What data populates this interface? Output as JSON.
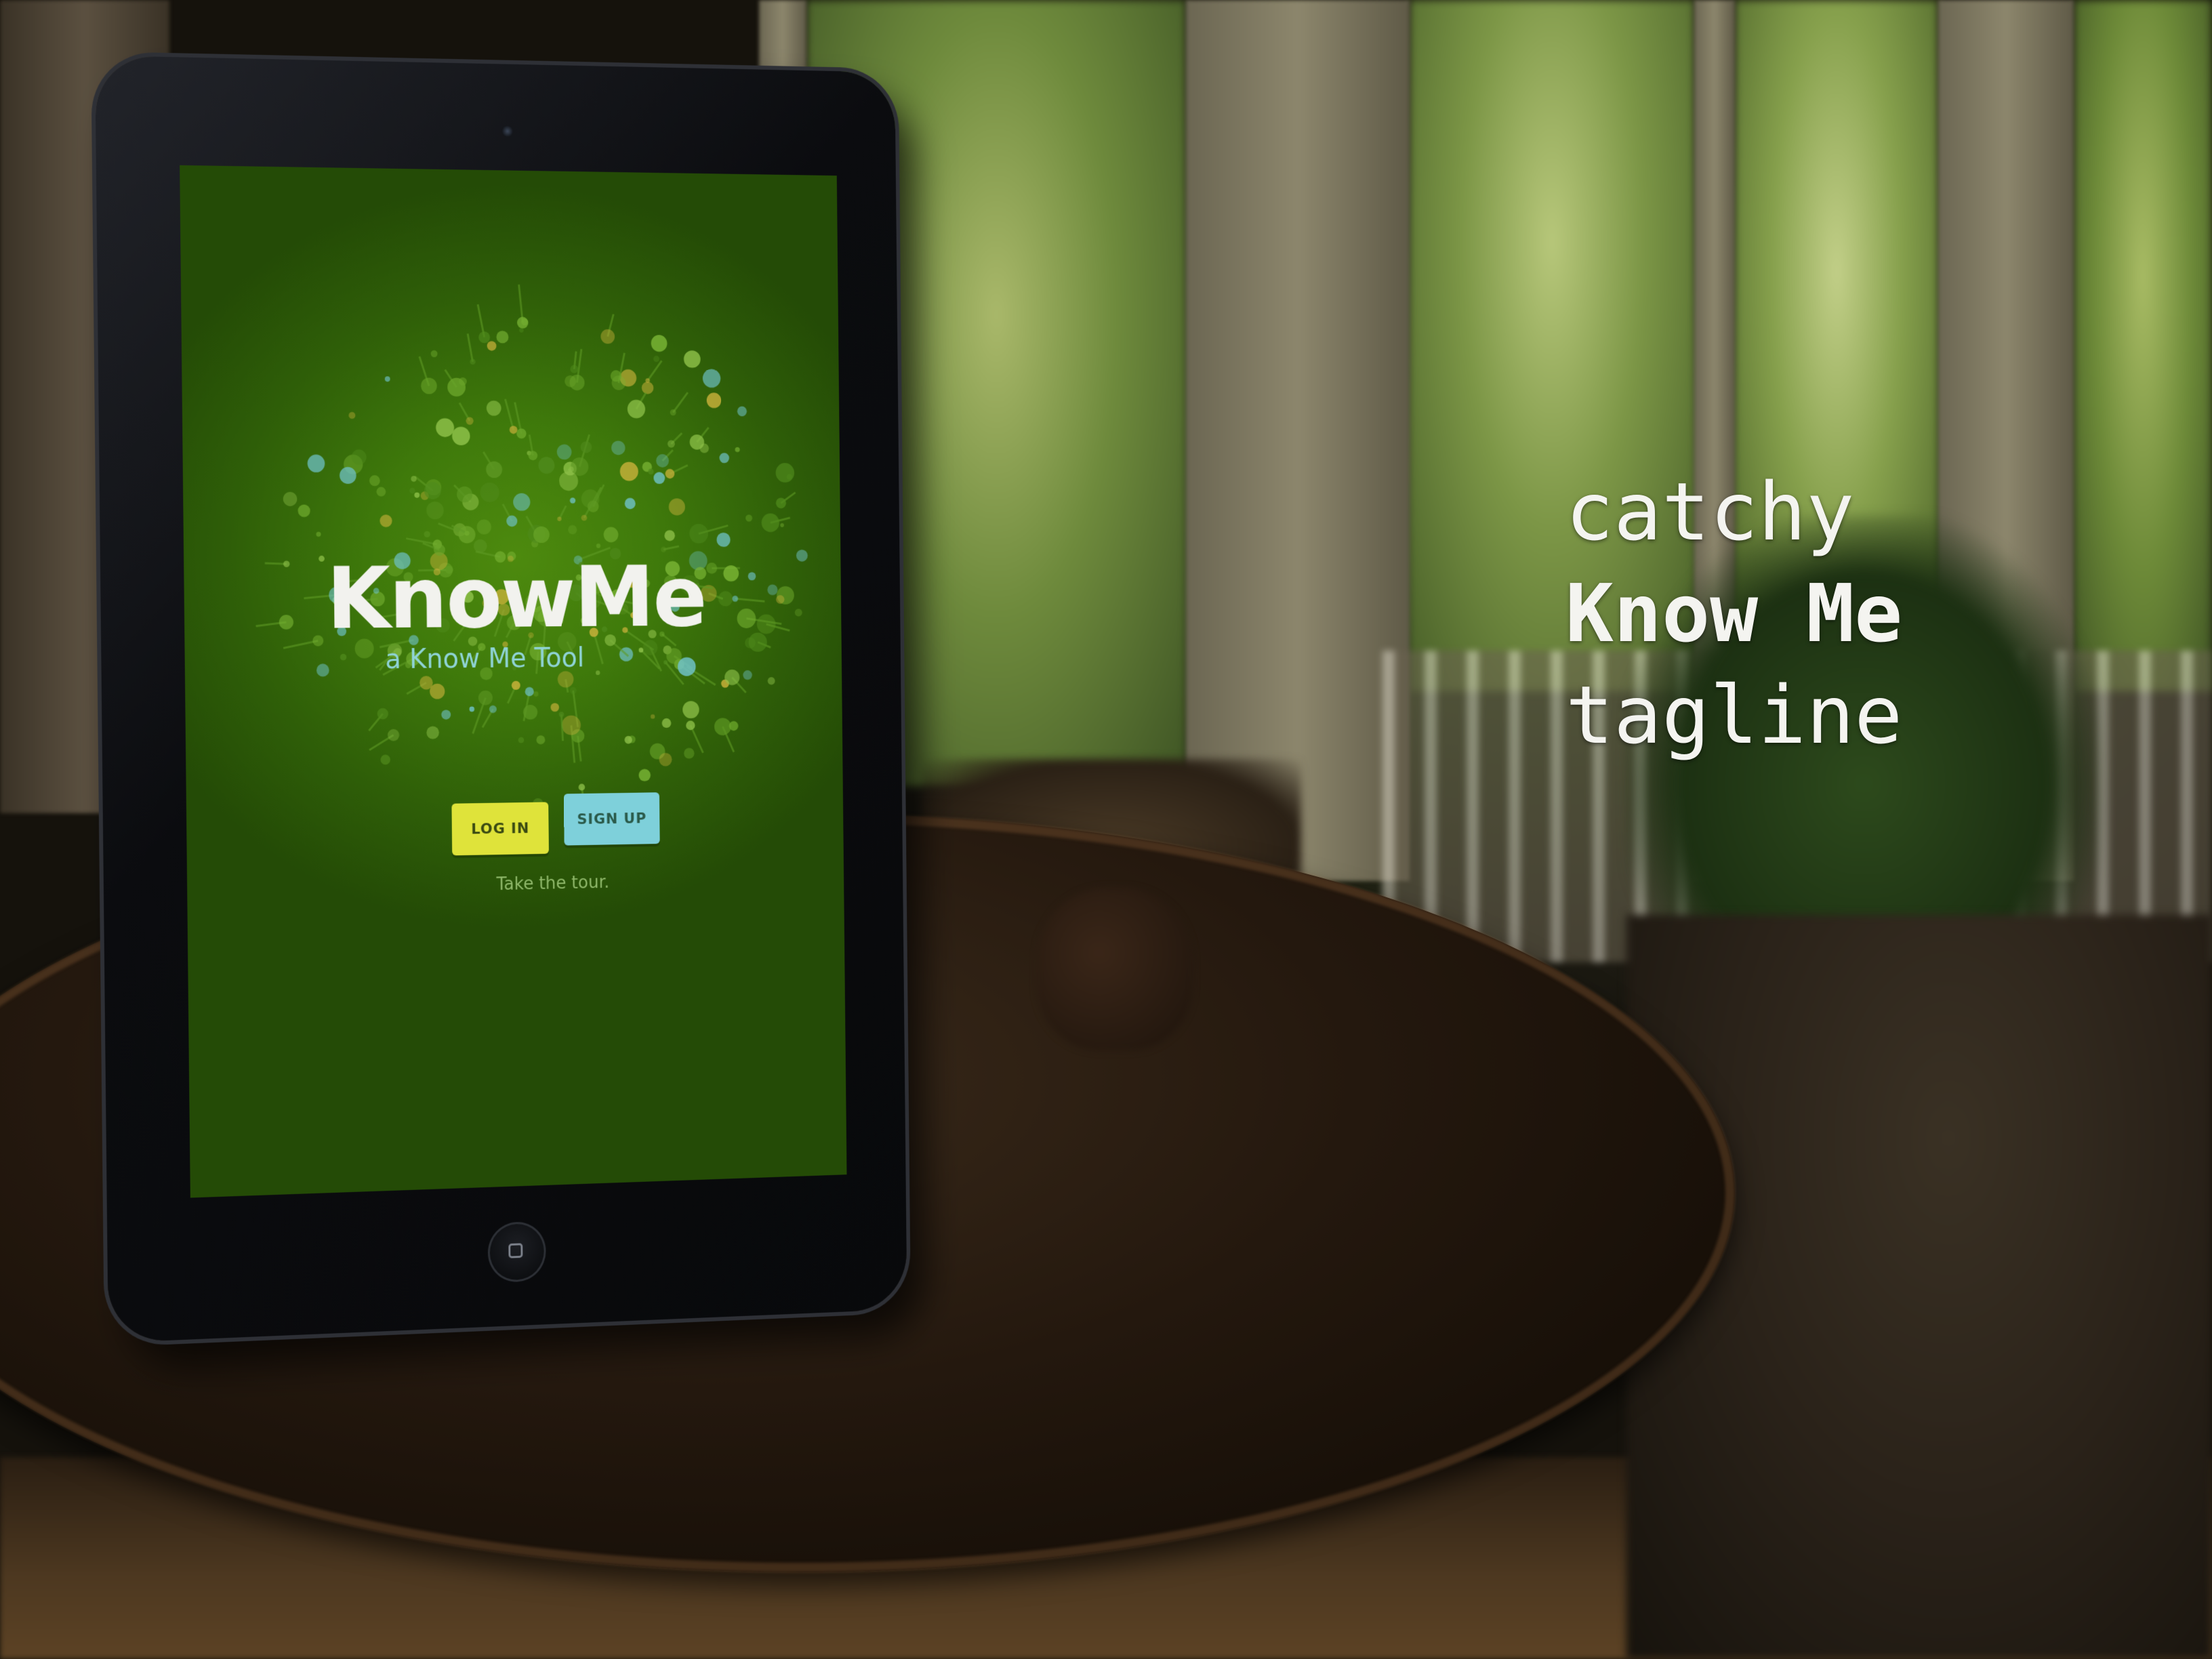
{
  "app": {
    "logo_text": "KnowMe",
    "subtitle": "a Know Me Tool"
  },
  "buttons": {
    "login_label": "LOG IN",
    "signup_label": "SIGN UP"
  },
  "tour": {
    "label": "Take the tour."
  },
  "tagline": {
    "line1": "catchy",
    "line2": "Know Me",
    "line3": "tagline"
  },
  "colors": {
    "screen_green": "#3f7a0b",
    "login_yellow": "#dfe33a",
    "signup_blue": "#7ed0da",
    "subtitle_teal": "#8fd3d6"
  },
  "icons": {
    "home": "home-button-icon",
    "camera": "front-camera-icon"
  }
}
